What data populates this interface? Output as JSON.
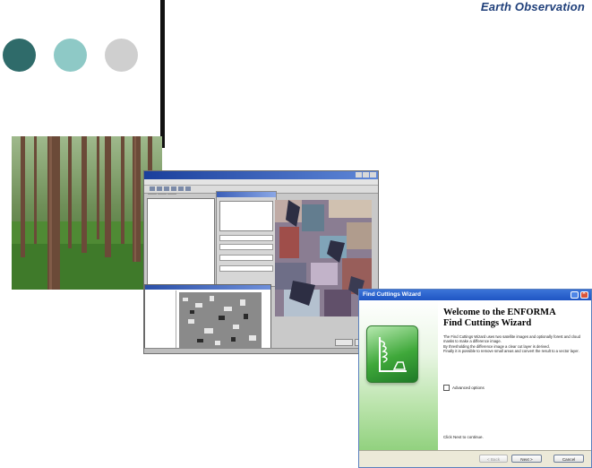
{
  "header": {
    "title": "Earth Observation"
  },
  "colors": {
    "dot1": "#2f6b6a",
    "dot2": "#8ec9c6",
    "dot3": "#cfcfcf",
    "title": "#1f3f7a"
  },
  "wizard": {
    "window_title": "Find Cuttings Wizard",
    "heading_line1": "Welcome to the ENFORMA",
    "heading_line2": "Find Cuttings Wizard",
    "description": [
      "The Find Cuttings Wizard uses two satellite images and optionally forest and cloud masks to make a difference image.",
      "By thresholding the difference image a clear cut layer is derived.",
      "Finally it is possible to remove small areas and convert the result to a vector layer."
    ],
    "advanced_options_label": "Advanced options",
    "advanced_options_checked": false,
    "hint": "Click Next to continue.",
    "buttons": {
      "back": "< Back",
      "next": "Next >",
      "cancel": "Cancel"
    }
  },
  "icons": [
    "minimize-icon",
    "close-icon",
    "wizard-logo-icon"
  ]
}
